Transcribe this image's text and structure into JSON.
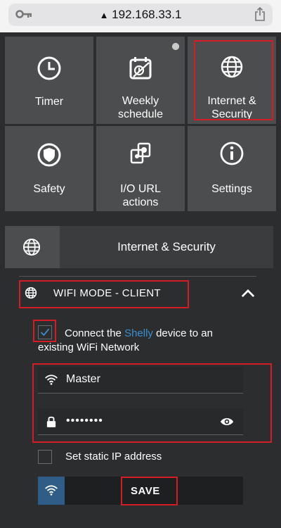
{
  "browser": {
    "url": "192.168.33.1"
  },
  "tiles": [
    {
      "label": "Timer",
      "icon": "clock-icon"
    },
    {
      "label": "Weekly schedule",
      "icon": "calendar-icon"
    },
    {
      "label": "Internet & Security",
      "icon": "globe-icon"
    },
    {
      "label": "Safety",
      "icon": "shield-icon"
    },
    {
      "label": "I/O URL actions",
      "icon": "url-actions-icon"
    },
    {
      "label": "Settings",
      "icon": "info-icon"
    }
  ],
  "section": {
    "title": "Internet & Security"
  },
  "wifi_mode": {
    "title": "WIFI MODE - CLIENT"
  },
  "connect": {
    "prefix": "Connect the ",
    "link": "Shelly",
    "suffix": " device to an existing WiFi Network",
    "checked": true
  },
  "ssid": {
    "value": "Master"
  },
  "password": {
    "value": "••••••••"
  },
  "static_ip": {
    "label": "Set static IP address",
    "checked": false
  },
  "save": {
    "label": "SAVE"
  },
  "colors": {
    "accent": "#3b8fd4",
    "highlight": "#d51c24",
    "tile": "#4b4d4f",
    "background": "#2b2d2f"
  }
}
